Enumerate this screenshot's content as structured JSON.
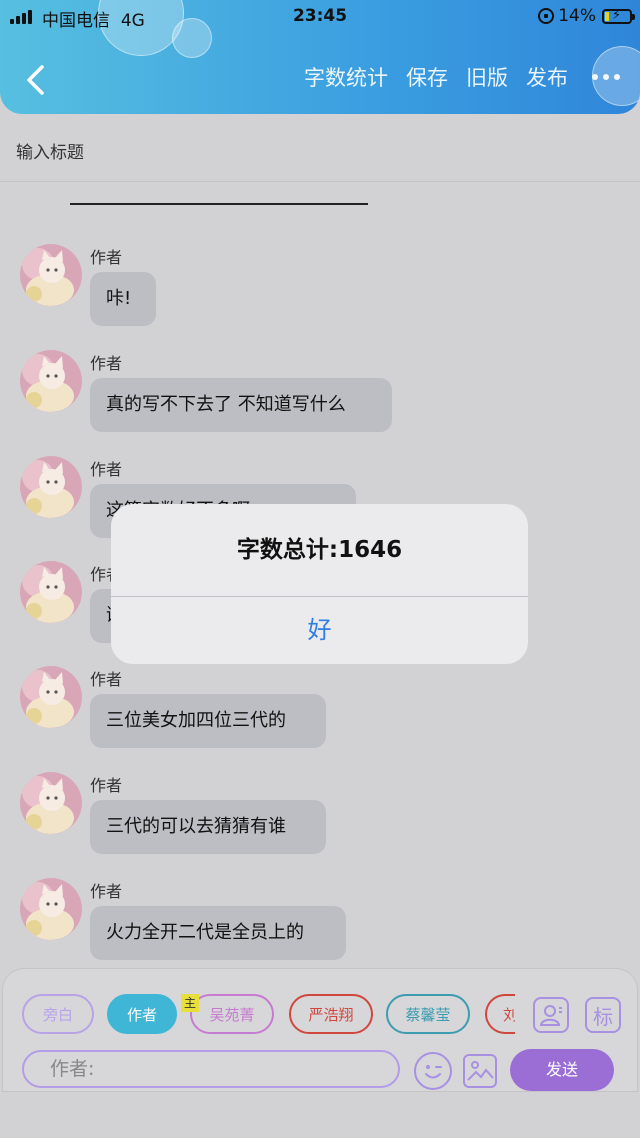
{
  "status_bar": {
    "carrier": "中国电信",
    "network": "4G",
    "time": "23:45",
    "battery": "14%"
  },
  "header": {
    "back_icon": "chevron-left-icon",
    "actions": [
      "字数统计",
      "保存",
      "旧版",
      "发布"
    ],
    "more_icon": "more-dots-icon"
  },
  "title_input": {
    "placeholder": "输入标题"
  },
  "messages": [
    {
      "author": "作者",
      "text": "咔!"
    },
    {
      "author": "作者",
      "text": "真的写不下去了 不知道写什么"
    },
    {
      "author": "作者",
      "text": "这篇字数好不多啊"
    },
    {
      "author": "作者",
      "text": "谢谢大家"
    },
    {
      "author": "作者",
      "text": "三位美女加四位三代的"
    },
    {
      "author": "作者",
      "text": "三代的可以去猜猜有谁"
    },
    {
      "author": "作者",
      "text": "火力全开二代是全员上的"
    }
  ],
  "dialog": {
    "message": "字数总计:1646",
    "ok_label": "好"
  },
  "roles": [
    {
      "label": "旁白",
      "color": "#b9a3e8",
      "active": false
    },
    {
      "label": "作者",
      "color": "#3fb6d6",
      "active": true
    },
    {
      "label": "吴苑菁",
      "color": "#c77bd0",
      "active": false
    },
    {
      "label": "严浩翔",
      "color": "#d0473e",
      "active": false
    },
    {
      "label": "蔡馨莹",
      "color": "#3d9cb0",
      "active": false
    },
    {
      "label": "刘",
      "color": "#d0473e",
      "active": false
    }
  ],
  "host_badge": "主",
  "tools": {
    "character_icon": "character-icon",
    "tag_label": "标"
  },
  "composer": {
    "placeholder": "作者:",
    "send_label": "发送",
    "emoji_icon": "emoji-wink-icon",
    "image_icon": "image-icon"
  }
}
